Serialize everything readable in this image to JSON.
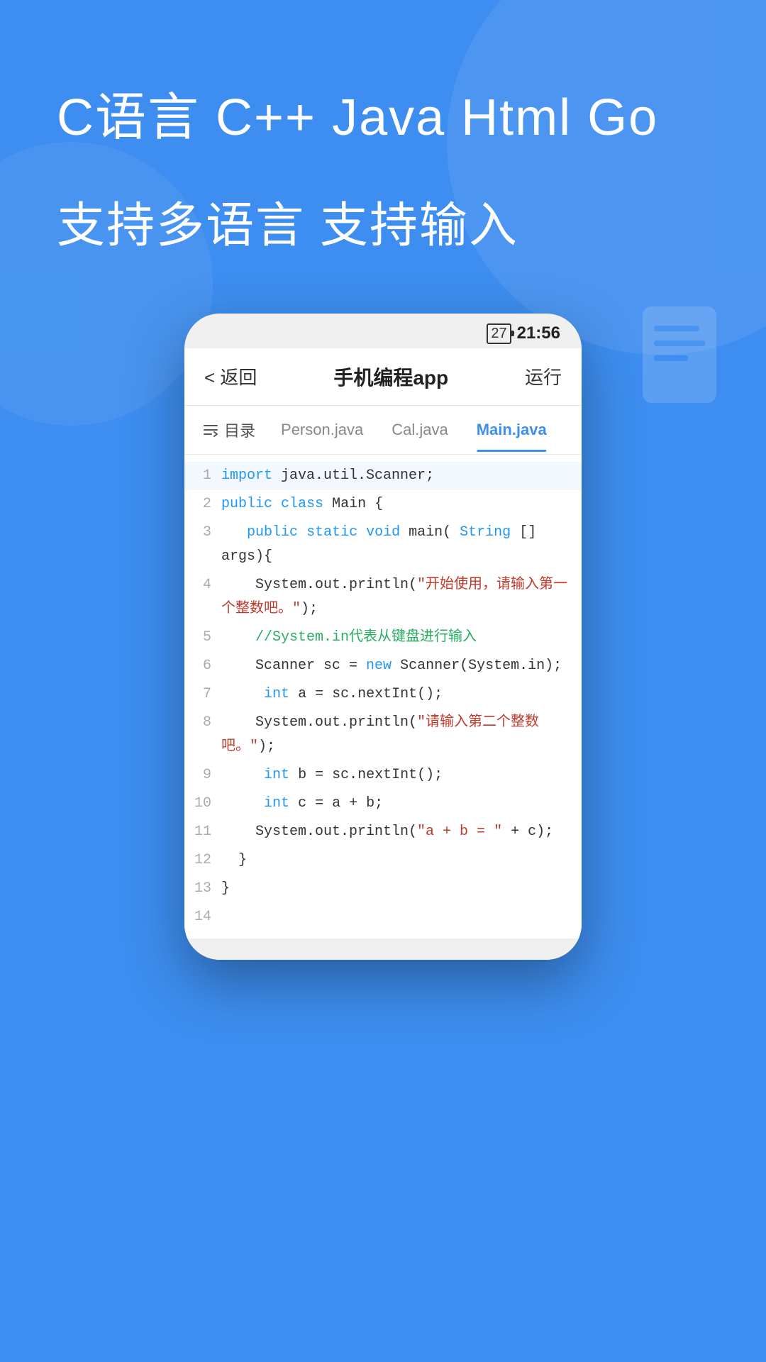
{
  "background": {
    "color": "#3d8ef0"
  },
  "header": {
    "headline": "C语言 C++ Java Html Go",
    "subtitle": "支持多语言 支持输入"
  },
  "phone": {
    "status_bar": {
      "battery": "27",
      "time": "21:56"
    },
    "app_header": {
      "back_label": "< 返回",
      "title": "手机编程app",
      "run_label": "运行"
    },
    "tabs": {
      "catalog_label": "目录",
      "tab1_label": "Person.java",
      "tab2_label": "Cal.java",
      "tab3_label": "Main.java"
    },
    "code": {
      "lines": [
        {
          "num": "1",
          "content": "import java.util.Scanner;"
        },
        {
          "num": "2",
          "content": "public class Main {"
        },
        {
          "num": "3",
          "content": "  public static void main(String[] args){"
        },
        {
          "num": "4",
          "content": "    System.out.println(\"开始使用，请输入第一个整数吧。\");"
        },
        {
          "num": "5",
          "content": "    //System.in代表从键盘进行输入"
        },
        {
          "num": "6",
          "content": "    Scanner sc = new Scanner(System.in);"
        },
        {
          "num": "7",
          "content": "    int a = sc.nextInt();"
        },
        {
          "num": "8",
          "content": "    System.out.println(\"请输入第二个整数吧。\");"
        },
        {
          "num": "9",
          "content": "    int b = sc.nextInt();"
        },
        {
          "num": "10",
          "content": "    int c = a + b;"
        },
        {
          "num": "11",
          "content": "    System.out.println(\"a + b = \" + c);"
        },
        {
          "num": "12",
          "content": "  }"
        },
        {
          "num": "13",
          "content": "}"
        },
        {
          "num": "14",
          "content": ""
        }
      ]
    }
  }
}
